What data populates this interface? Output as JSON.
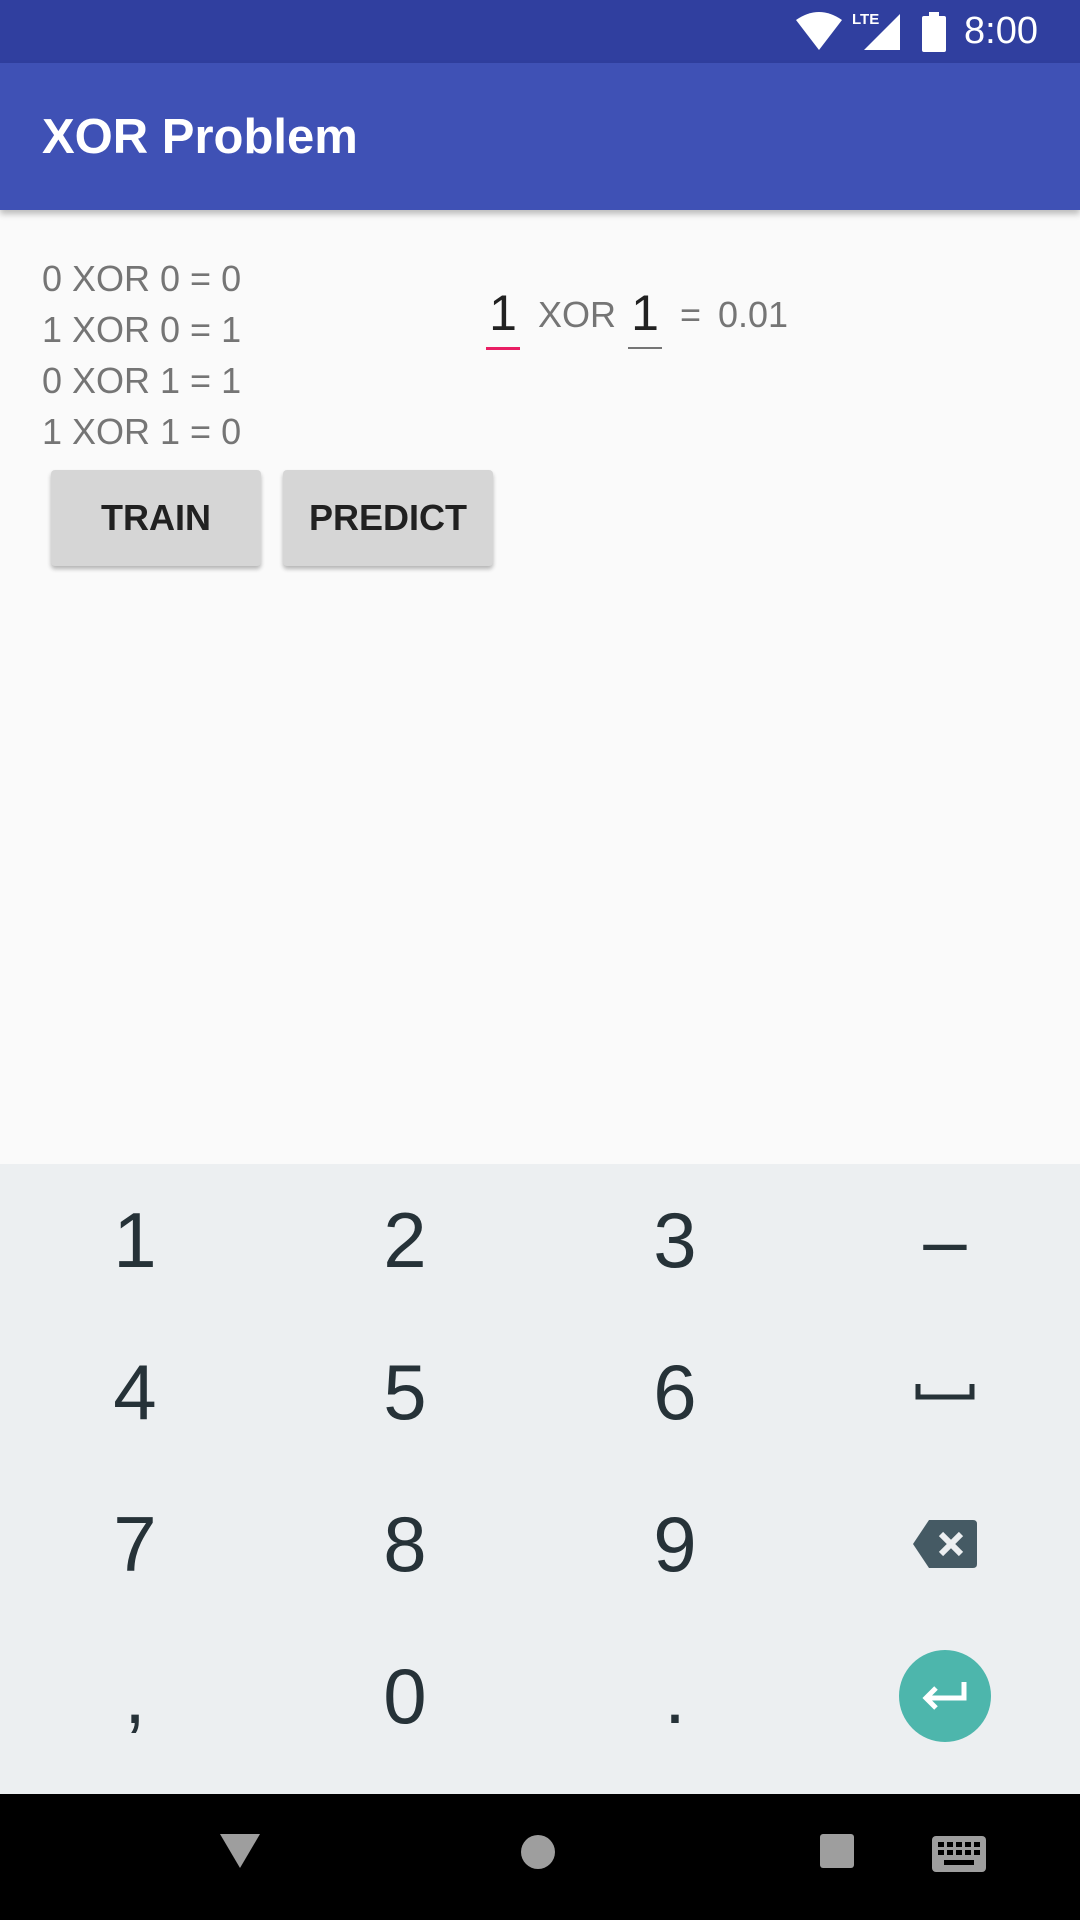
{
  "status_bar": {
    "time": "8:00",
    "network": "LTE"
  },
  "app_bar": {
    "title": "XOR Problem"
  },
  "truth_table": [
    "0 XOR 0 = 0",
    "1 XOR 0 = 1",
    "0 XOR 1 = 1",
    "1 XOR 1 = 0"
  ],
  "equation": {
    "input_a": "1",
    "operator": "XOR",
    "input_b": "1",
    "equals": "=",
    "result": "0.01"
  },
  "buttons": {
    "train": "TRAIN",
    "predict": "PREDICT"
  },
  "keyboard": {
    "rows": [
      [
        "1",
        "2",
        "3",
        "–"
      ],
      [
        "4",
        "5",
        "6",
        "␣"
      ],
      [
        "7",
        "8",
        "9",
        "backspace"
      ],
      [
        ",",
        "0",
        ".",
        "enter"
      ]
    ]
  },
  "colors": {
    "status_bar": "#303f9f",
    "app_bar": "#3f51b5",
    "focus_accent": "#e91e63",
    "enter_key": "#4db6ac"
  }
}
